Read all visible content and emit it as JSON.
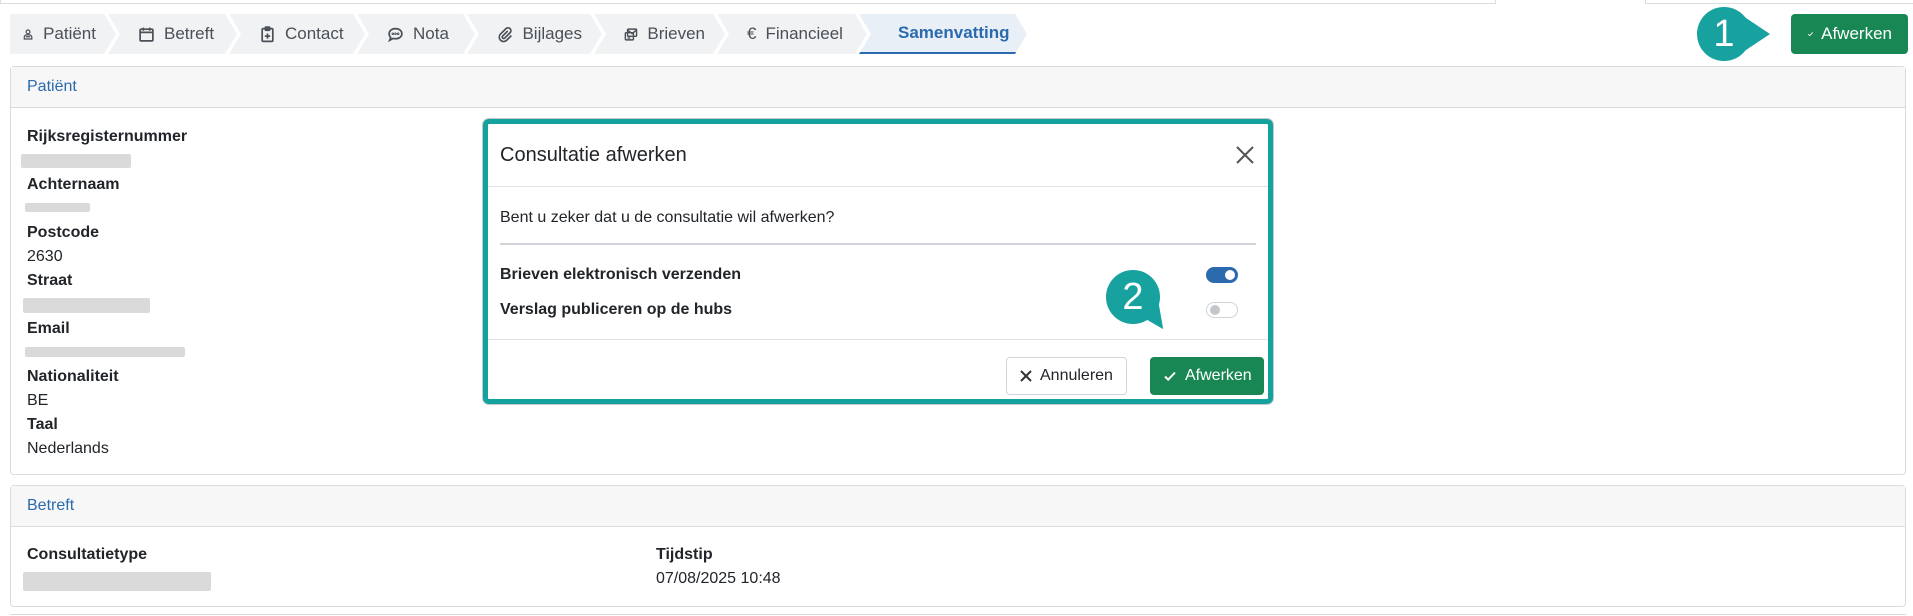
{
  "tabs": [
    {
      "label": "Patiënt",
      "icon": "person-icon"
    },
    {
      "label": "Betreft",
      "icon": "calendar-icon"
    },
    {
      "label": "Contact",
      "icon": "clipboard-plus-icon"
    },
    {
      "label": "Nota",
      "icon": "chat-icon"
    },
    {
      "label": "Bijlages",
      "icon": "paperclip-icon"
    },
    {
      "label": "Brieven",
      "icon": "letters-icon"
    },
    {
      "label": "Financieel",
      "icon": "euro-icon"
    },
    {
      "label": "Samenvatting",
      "icon": "check-icon",
      "active": true
    }
  ],
  "header": {
    "finish_label": "Afwerken"
  },
  "markers": {
    "one": "1",
    "two": "2"
  },
  "patient_card": {
    "title": "Patiënt",
    "rijksregister_label": "Rijksregisternummer",
    "achternaam_label": "Achternaam",
    "postcode_label": "Postcode",
    "postcode_value": "2630",
    "straat_label": "Straat",
    "email_label": "Email",
    "nationaliteit_label": "Nationaliteit",
    "nationaliteit_value": "BE",
    "taal_label": "Taal",
    "taal_value": "Nederlands"
  },
  "betreft_card": {
    "title": "Betreft",
    "consultatietype_label": "Consultatietype",
    "tijdstip_label": "Tijdstip",
    "tijdstip_value": "07/08/2025 10:48"
  },
  "modal": {
    "title": "Consultatie afwerken",
    "question": "Bent u zeker dat u de consultatie wil afwerken?",
    "option_brieven": "Brieven elektronisch verzenden",
    "option_brieven_on": true,
    "option_hubs": "Verslag publiceren op de hubs",
    "option_hubs_on": false,
    "cancel_label": "Annuleren",
    "finish_label": "Afwerken"
  },
  "colors": {
    "accent": "#2a6aad",
    "success": "#198754",
    "callout": "#17a2a0"
  }
}
